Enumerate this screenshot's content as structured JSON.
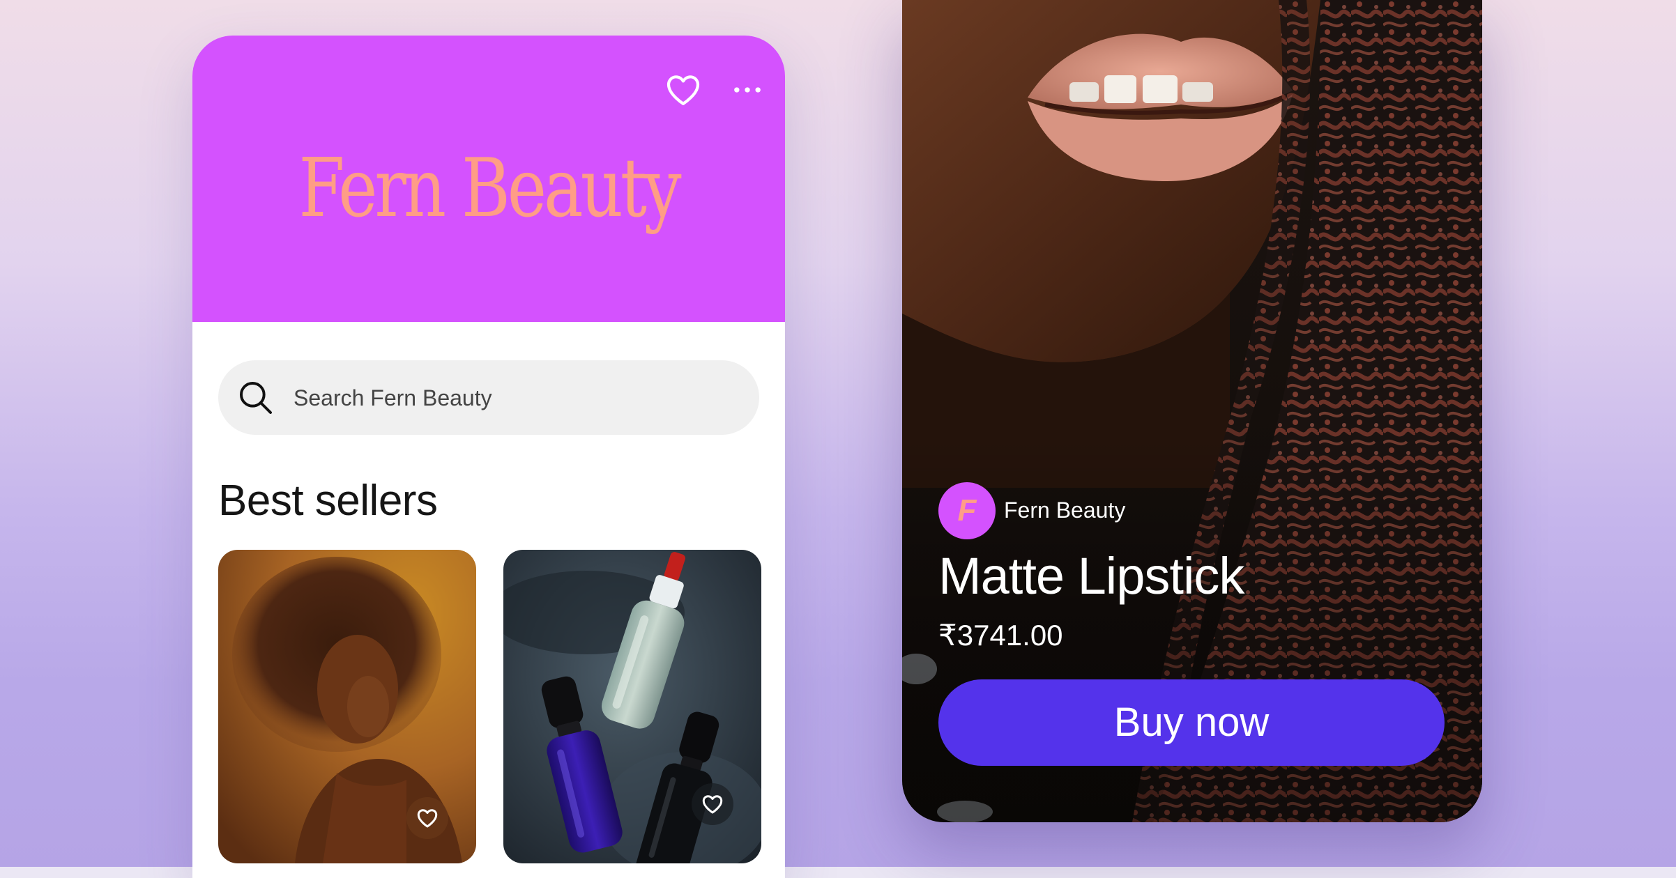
{
  "store": {
    "brand_name": "Fern Beauty",
    "search_placeholder": "Search Fern Beauty",
    "section_title": "Best sellers",
    "icons": {
      "favorite": "heart-outline-icon",
      "more": "more-horizontal-icon",
      "search": "magnifier-icon"
    },
    "products": [
      {
        "image": "woman-portrait-photo",
        "favorite_icon": "heart-outline-icon"
      },
      {
        "image": "serum-bottles-photo",
        "favorite_icon": "heart-outline-icon"
      }
    ]
  },
  "product_detail": {
    "brand_initial": "F",
    "brand_name": "Fern Beauty",
    "title": "Matte Lipstick",
    "price": "₹3741.00",
    "cta_label": "Buy now"
  },
  "colors": {
    "brand_purple": "#d452fe",
    "brand_peach": "#ff9d86",
    "cta_blue": "#5433eb",
    "search_bg": "#f0f0f0"
  }
}
